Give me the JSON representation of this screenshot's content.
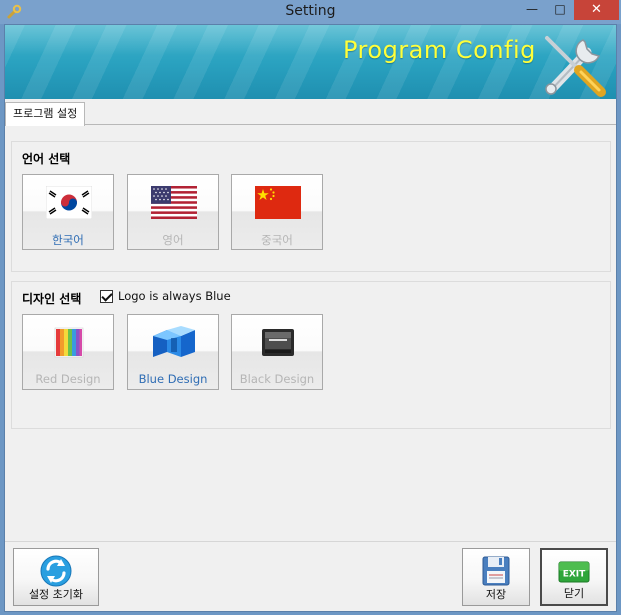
{
  "window": {
    "title": "Setting",
    "minimize_glyph": "—",
    "maximize_glyph": "□",
    "close_glyph": "✕"
  },
  "banner": {
    "title": "Program Config",
    "icon": "tools-icon",
    "title_color": "#ffff3a"
  },
  "tabs": [
    {
      "label": "프로그램 설정",
      "active": true
    }
  ],
  "language": {
    "title": "언어 선택",
    "options": [
      {
        "label": "한국어",
        "icon": "korea-flag-icon",
        "selected": true
      },
      {
        "label": "영어",
        "icon": "usa-flag-icon",
        "selected": false
      },
      {
        "label": "중국어",
        "icon": "china-flag-icon",
        "selected": false
      }
    ]
  },
  "design": {
    "title": "디자인 선택",
    "logo_checkbox": {
      "label": "Logo is always Blue",
      "checked": true
    },
    "options": [
      {
        "label": "Red Design",
        "icon": "red-design-icon",
        "selected": false
      },
      {
        "label": "Blue Design",
        "icon": "blue-design-icon",
        "selected": true
      },
      {
        "label": "Black Design",
        "icon": "black-design-icon",
        "selected": false
      }
    ]
  },
  "footer": {
    "reset_label": "설정 초기화",
    "save_label": "저장",
    "close_label": "닫기",
    "exit_icon_text": "EXIT"
  },
  "colors": {
    "selected_text": "#2f6db4",
    "disabled_text": "#b5b5b5",
    "titlebar": "#7aa1cc",
    "close_button": "#c74439"
  }
}
